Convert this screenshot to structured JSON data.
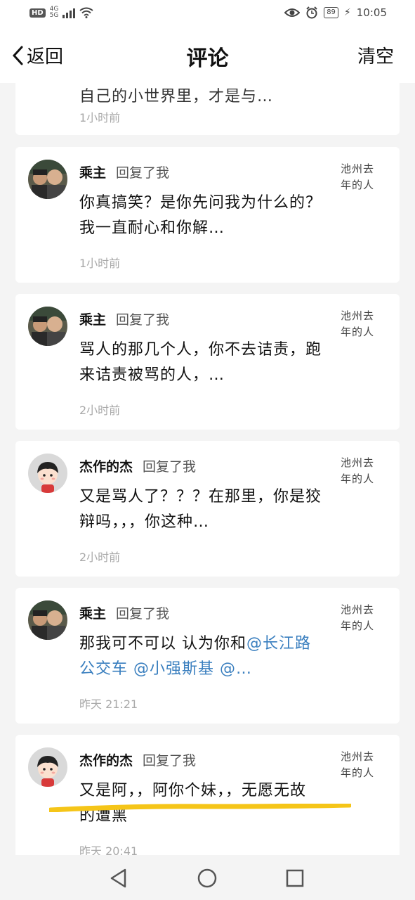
{
  "status_bar": {
    "hd": "HD",
    "network": "4G",
    "network_sub": "5G",
    "battery": "89",
    "time": "10:05"
  },
  "header": {
    "back_label": "返回",
    "title": "评论",
    "clear_label": "清空"
  },
  "comments": [
    {
      "content_partial": "自己的小世界里，才是与…",
      "time": "1小时前"
    },
    {
      "name": "乘主",
      "action": "回复了我",
      "content": "你真搞笑？是你先问我为什么的？我一直耐心和你解…",
      "time": "1小时前",
      "ref": "池州去年的人 …"
    },
    {
      "name": "乘主",
      "action": "回复了我",
      "content": "骂人的那几个人，你不去诘责，跑来诘责被骂的人，…",
      "time": "2小时前",
      "ref": "池州去年的人 …"
    },
    {
      "name": "杰作的杰",
      "action": "回复了我",
      "content": "又是骂人了？？？在那里，你是狡辩吗，，，你这种…",
      "time": "2小时前",
      "ref": "池州去年的人 …"
    },
    {
      "name": "乘主",
      "action": "回复了我",
      "content_plain": "那我可不可以 认为你和",
      "content_mentions": "@长江路公交车 @小强斯基 @…",
      "time": "昨天 21:21",
      "ref": "池州去年的人 …"
    },
    {
      "name": "杰作的杰",
      "action": "回复了我",
      "content": "又是阿，，阿你个妹，，无愿无故的遭黑",
      "time": "昨天 20:41",
      "ref": "池州去年的人 …"
    }
  ],
  "colors": {
    "mention": "#3a7fbf",
    "highlight": "#f5c518",
    "time": "#a9a9a9"
  }
}
